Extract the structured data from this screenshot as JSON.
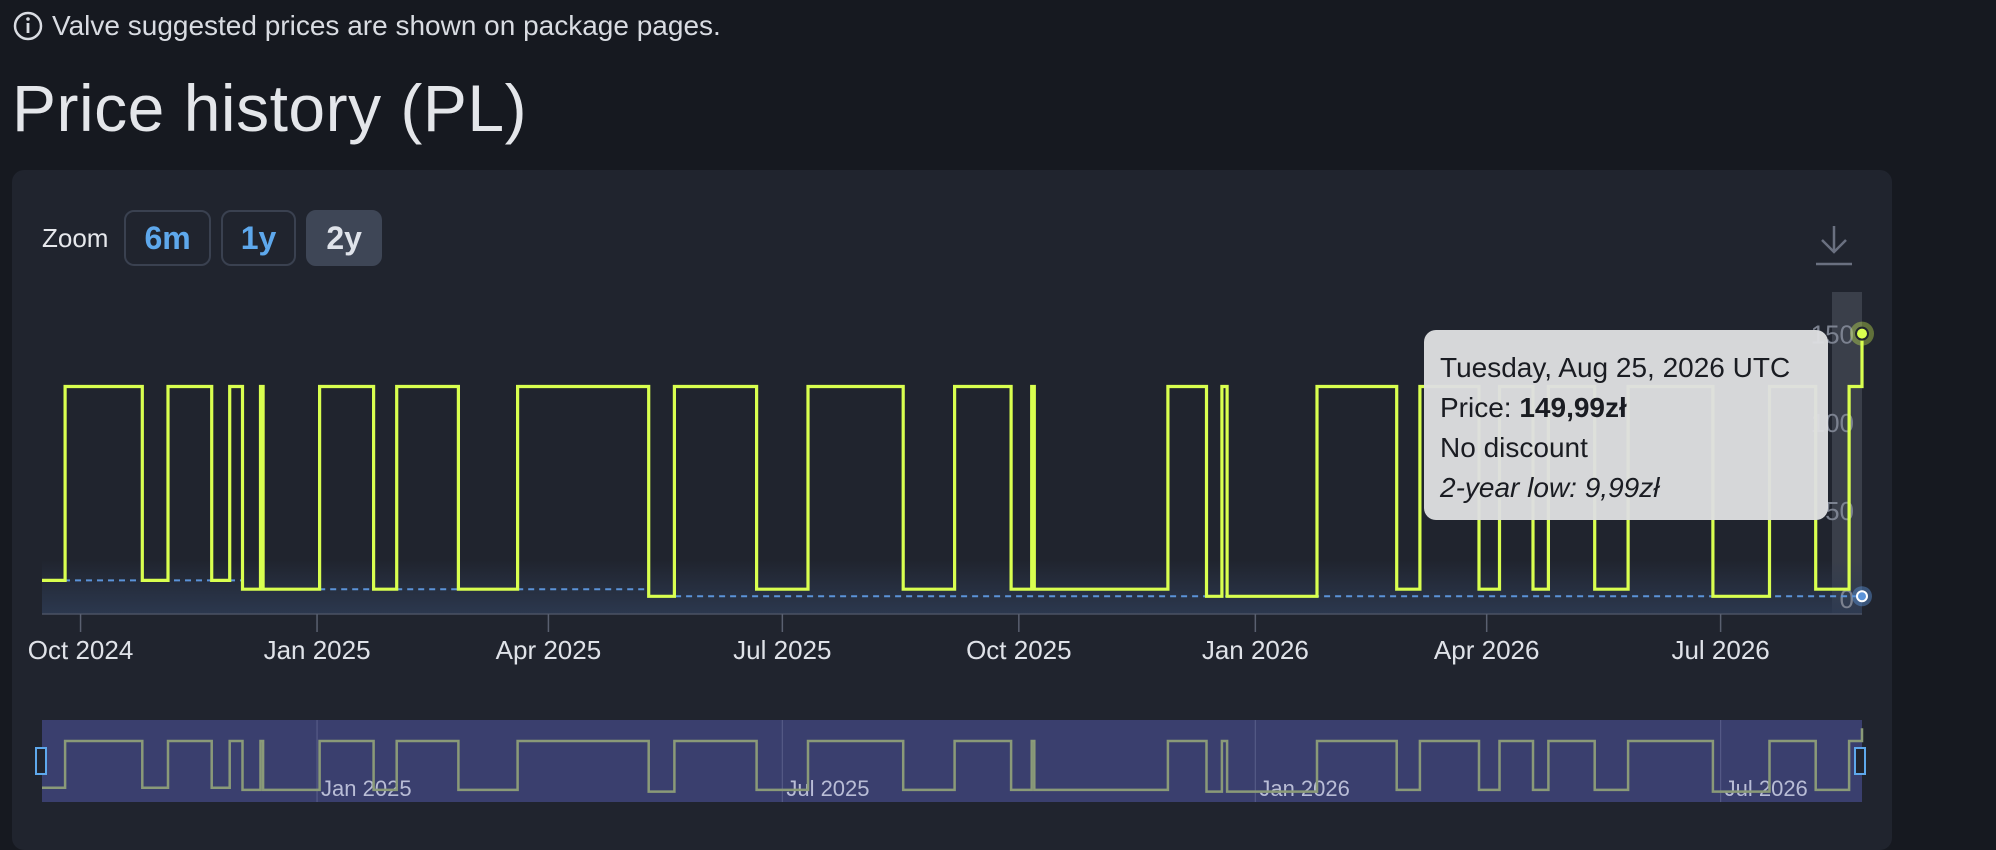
{
  "notice": {
    "text": "Valve suggested prices are shown on package pages.",
    "icon": "info-icon"
  },
  "page_title": "Price history (PL)",
  "zoom": {
    "label": "Zoom",
    "buttons": [
      "6m",
      "1y",
      "2y"
    ],
    "active": "2y"
  },
  "download": {
    "icon": "download-icon"
  },
  "tooltip": {
    "date": "Tuesday, Aug 25, 2026 UTC",
    "price_label": "Price: ",
    "price_value": "149,99zł",
    "discount": "No discount",
    "low": "2-year low: 9,99zł"
  },
  "colors": {
    "line": "#d9ff4f",
    "navigator_line": "#8a9a78",
    "low_line": "#5b93d8",
    "navigator_bg": "#3a3f6e",
    "plot_band": "#3a3f4a"
  },
  "chart_data": {
    "type": "line",
    "step": true,
    "currency": "zł",
    "x_tick_labels": [
      "Oct 2024",
      "Jan 2025",
      "Apr 2025",
      "Jul 2025",
      "Oct 2025",
      "Jan 2026",
      "Apr 2026",
      "Jul 2026"
    ],
    "x_ticks": [
      "2024-10-01",
      "2025-01-01",
      "2025-04-01",
      "2025-07-01",
      "2025-10-01",
      "2026-01-01",
      "2026-04-01",
      "2026-07-01"
    ],
    "xlim": [
      "2024-09-16",
      "2026-08-25"
    ],
    "y_tick_labels": [
      "0",
      "50",
      "100",
      "150"
    ],
    "ylim": [
      0,
      160
    ],
    "grid": false,
    "series": [
      {
        "x": [
          "2024-09-16",
          "2024-09-25",
          "2024-10-25",
          "2024-11-04",
          "2024-11-21",
          "2024-11-28",
          "2024-12-03",
          "2024-12-10",
          "2024-12-11",
          "2024-12-12",
          "2025-01-02",
          "2025-01-23",
          "2025-02-01",
          "2025-02-25",
          "2025-03-19",
          "2025-03-20",
          "2025-05-10",
          "2025-05-20",
          "2025-06-21",
          "2025-07-11",
          "2025-08-17",
          "2025-09-06",
          "2025-09-28",
          "2025-10-06",
          "2025-10-07",
          "2025-11-28",
          "2025-12-13",
          "2025-12-19",
          "2025-12-21",
          "2025-12-26",
          "2026-01-25",
          "2026-02-25",
          "2026-03-06",
          "2026-03-29",
          "2026-04-06",
          "2026-04-19",
          "2026-04-25",
          "2026-05-13",
          "2026-05-26",
          "2026-06-28",
          "2026-07-20",
          "2026-08-07",
          "2026-08-20",
          "2026-08-25"
        ],
        "y": [
          9.99,
          119.99,
          9.99,
          119.99,
          9.99,
          119.99,
          4.99,
          119.99,
          4.99,
          4.99,
          119.99,
          4.99,
          119.99,
          4.99,
          4.99,
          119.99,
          0.99,
          119.99,
          4.99,
          119.99,
          4.99,
          119.99,
          4.99,
          119.99,
          4.99,
          119.99,
          0.99,
          119.99,
          0.99,
          0.99,
          119.99,
          4.99,
          119.99,
          4.99,
          119.99,
          4.99,
          119.99,
          4.99,
          119.99,
          0.99,
          119.99,
          4.99,
          119.99,
          149.99
        ]
      }
    ],
    "low_line": {
      "x": [
        "2024-09-16",
        "2024-12-03",
        "2025-05-10",
        "2026-08-25"
      ],
      "y": [
        9.99,
        4.99,
        0.99,
        0.99
      ]
    },
    "navigator": {
      "tick_labels": [
        "Jan 2025",
        "Jul 2025",
        "Jan 2026",
        "Jul 2026"
      ],
      "ticks": [
        "2025-01-01",
        "2025-07-01",
        "2026-01-01",
        "2026-07-01"
      ]
    }
  }
}
